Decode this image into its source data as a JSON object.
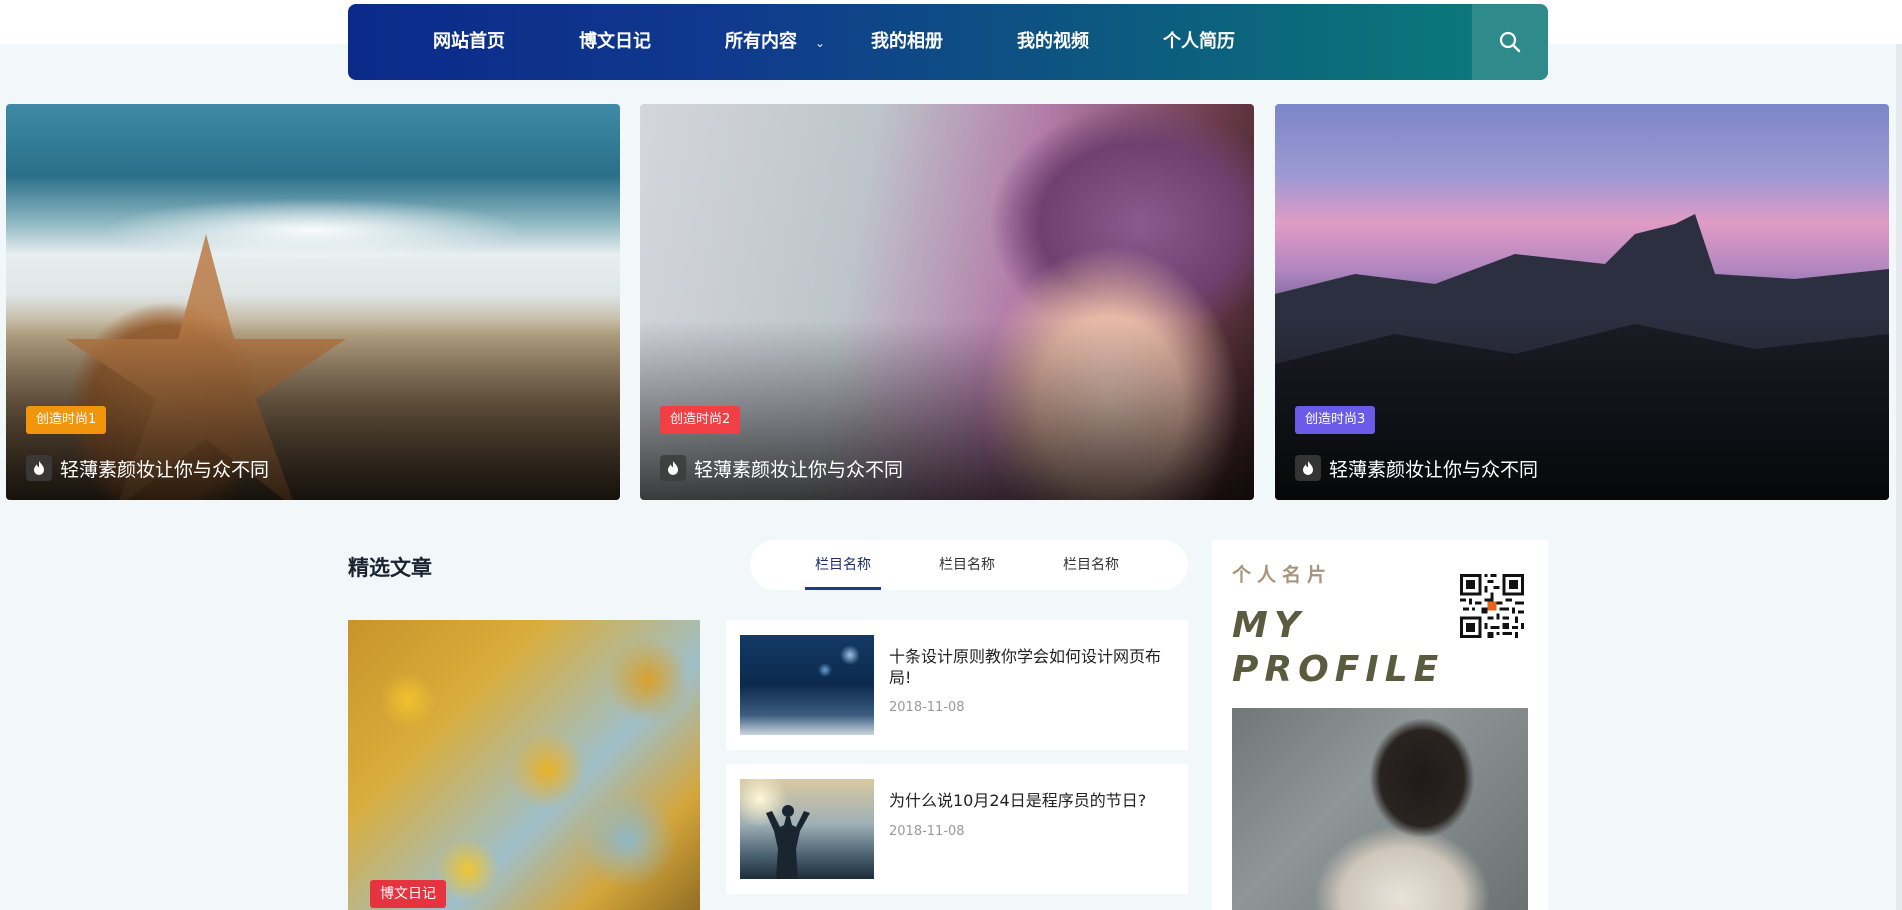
{
  "nav": {
    "items": [
      "网站首页",
      "博文日记",
      "所有内容",
      "我的相册",
      "我的视频",
      "个人简历"
    ],
    "search_icon": "search-icon"
  },
  "hero": [
    {
      "tag": "创造时尚1",
      "tag_color": "#f0950c",
      "title": "轻薄素颜妆让你与众不同"
    },
    {
      "tag": "创造时尚2",
      "tag_color": "#f04045",
      "title": "轻薄素颜妆让你与众不同"
    },
    {
      "tag": "创造时尚3",
      "tag_color": "#6a5ce8",
      "title": "轻薄素颜妆让你与众不同"
    }
  ],
  "featured": {
    "title": "精选文章",
    "tabs": [
      "栏目名称",
      "栏目名称",
      "栏目名称"
    ],
    "main_tag": "博文日记"
  },
  "articles": [
    {
      "title": "十条设计原则教你学会如何设计网页布局!",
      "date": "2018-11-08"
    },
    {
      "title": "为什么说10月24日是程序员的节日?",
      "date": "2018-11-08"
    }
  ],
  "profile": {
    "caption": "个人名片",
    "line1": "MY",
    "line2": "PROFILE"
  }
}
